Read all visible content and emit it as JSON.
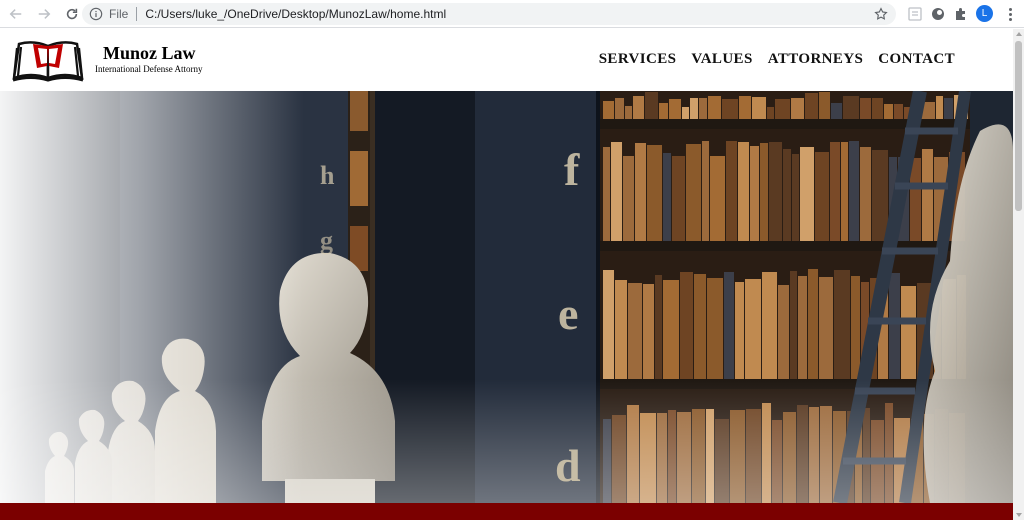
{
  "browser": {
    "scheme_label": "File",
    "url": "C:/Users/luke_/OneDrive/Desktop/MunozLaw/home.html",
    "profile_initial": "L"
  },
  "site": {
    "brand_name": "Munoz Law",
    "tagline": "International Defense Attorny",
    "nav": [
      "SERVICES",
      "VALUES",
      "ATTORNEYS",
      "CONTACT"
    ]
  },
  "hero": {
    "shelf_letters": [
      "f",
      "e",
      "d",
      "h",
      "g"
    ]
  },
  "colors": {
    "accent_band": "#7b0000",
    "logo_red": "#c00000"
  }
}
